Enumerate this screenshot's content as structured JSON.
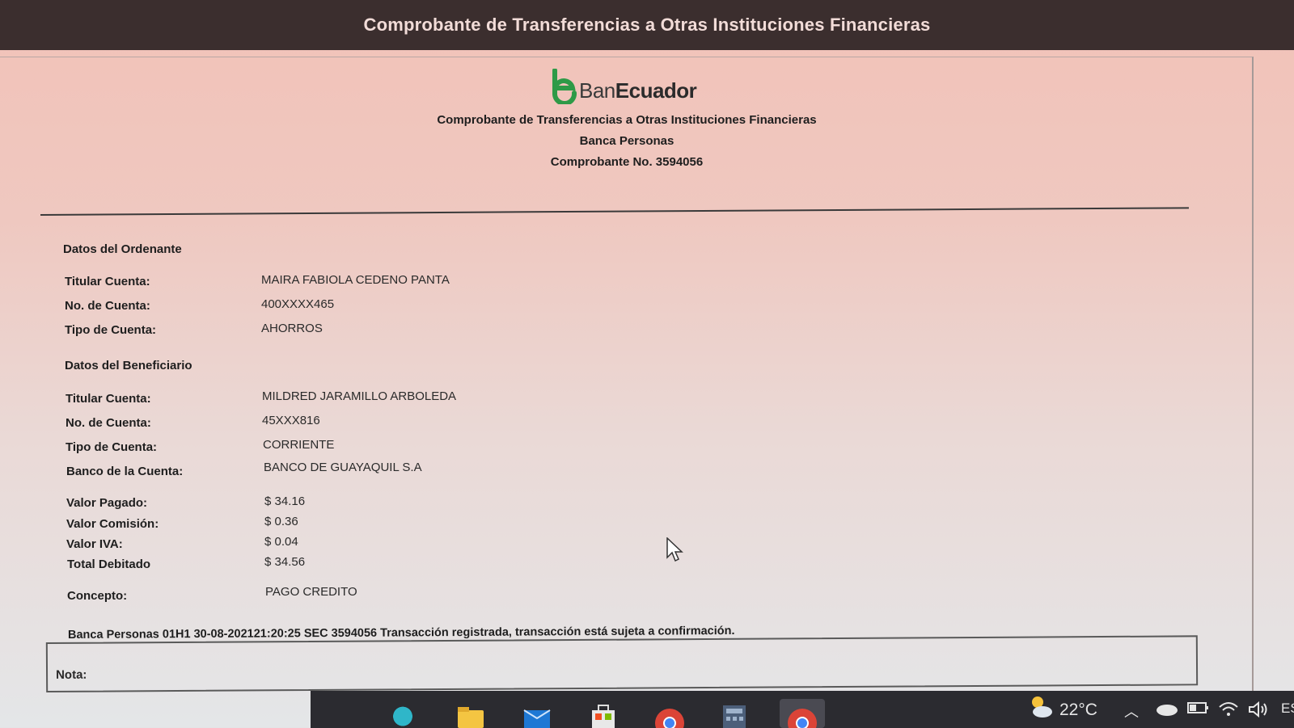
{
  "window": {
    "title": "Comprobante de Transferencias a Otras Instituciones Financieras"
  },
  "brand": {
    "logo_text_ban": "Ban",
    "logo_text_ecuador": "Ecuador",
    "accent_color": "#2e9a47"
  },
  "header": {
    "title": "Comprobante de Transferencias a Otras Instituciones Financieras",
    "subtitle": "Banca Personas",
    "receipt_number": "Comprobante No. 3594056"
  },
  "ordenante": {
    "section_title": "Datos del Ordenante",
    "fields": [
      {
        "label": "Titular Cuenta:",
        "value": "MAIRA FABIOLA CEDENO PANTA"
      },
      {
        "label": "No. de Cuenta:",
        "value": "400XXXX465"
      },
      {
        "label": "Tipo de Cuenta:",
        "value": "AHORROS"
      }
    ]
  },
  "beneficiario": {
    "section_title": "Datos del Beneficiario",
    "fields": [
      {
        "label": "Titular Cuenta:",
        "value": "MILDRED JARAMILLO ARBOLEDA"
      },
      {
        "label": "No. de Cuenta:",
        "value": "45XXX816"
      },
      {
        "label": "Tipo de Cuenta:",
        "value": "CORRIENTE"
      },
      {
        "label": "Banco de la Cuenta:",
        "value": "BANCO DE GUAYAQUIL S.A"
      }
    ]
  },
  "valores": {
    "fields": [
      {
        "label": "Valor Pagado:",
        "value": "$ 34.16"
      },
      {
        "label": "Valor Comisión:",
        "value": "$ 0.36"
      },
      {
        "label": "Valor IVA:",
        "value": "$ 0.04"
      },
      {
        "label": "Total Debitado",
        "value": "$ 34.56"
      }
    ]
  },
  "concepto": {
    "label": "Concepto:",
    "value": "PAGO CREDITO"
  },
  "status_line": "Banca Personas 01H1 30-08-202121:20:25 SEC 3594056 Transacción registrada, transacción está sujeta a confirmación.",
  "nota": {
    "label": "Nota:"
  },
  "taskbar": {
    "weather": "22°C",
    "language": "ES",
    "icons": [
      "edge-icon",
      "file-explorer-icon",
      "mail-icon",
      "store-icon",
      "chrome-icon",
      "calculator-icon",
      "chrome-active-icon"
    ]
  }
}
